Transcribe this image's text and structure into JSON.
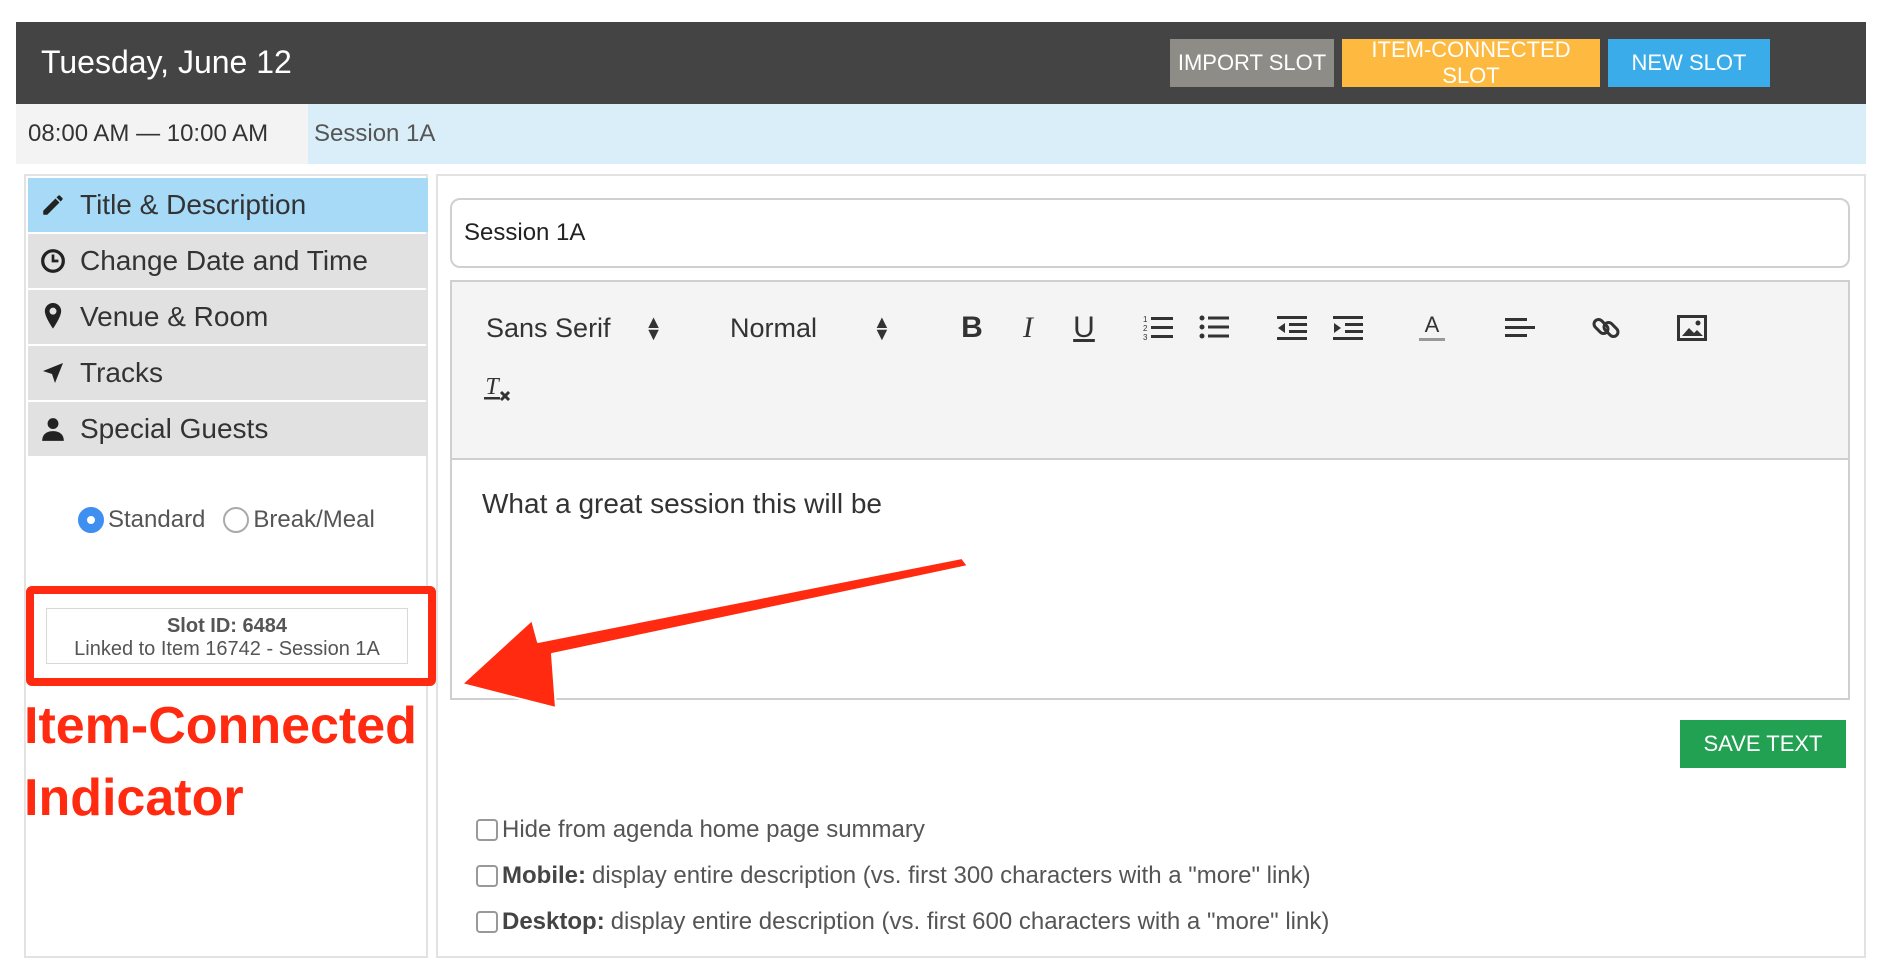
{
  "header": {
    "title": "Tuesday, June 12",
    "buttons": {
      "import": "IMPORT SLOT",
      "item_connected": "ITEM-CONNECTED SLOT",
      "new": "NEW SLOT"
    },
    "colors": {
      "bar": "#444444",
      "import": "#8e8c86",
      "item_connected": "#fdb940",
      "new": "#3aacea"
    }
  },
  "timebar": {
    "time_range": "08:00 AM — 10:00 AM",
    "session": "Session 1A"
  },
  "sidebar": {
    "items": [
      {
        "label": "Title & Description",
        "icon": "pencil-icon",
        "active": true
      },
      {
        "label": "Change Date and Time",
        "icon": "clock-icon",
        "active": false
      },
      {
        "label": "Venue & Room",
        "icon": "map-pin-icon",
        "active": false
      },
      {
        "label": "Tracks",
        "icon": "location-arrow-icon",
        "active": false
      },
      {
        "label": "Special Guests",
        "icon": "user-icon",
        "active": false
      }
    ],
    "slot_type": {
      "options": [
        "Standard",
        "Break/Meal"
      ],
      "selected": "Standard"
    },
    "slot_info": {
      "slot_id": "Slot ID: 6484",
      "linked": "Linked to Item 16742 - Session 1A"
    }
  },
  "annotation": {
    "line1": "Item-Connected",
    "line2": "Indicator",
    "color": "#ff2a0f"
  },
  "editor": {
    "title_value": "Session 1A",
    "font_family": "Sans Serif",
    "font_size": "Normal",
    "body": "What a great session this will be",
    "save_label": "SAVE TEXT",
    "toolbar_icons": [
      "bold-icon",
      "italic-icon",
      "underline-icon",
      "ordered-list-icon",
      "bullet-list-icon",
      "outdent-icon",
      "indent-icon",
      "text-color-icon",
      "align-icon",
      "link-icon",
      "image-icon",
      "clear-format-icon"
    ]
  },
  "options": {
    "hide": "Hide from agenda home page summary",
    "mobile_label": "Mobile:",
    "mobile_text": "display entire description (vs. first 300 characters with a \"more\" link)",
    "desktop_label": "Desktop:",
    "desktop_text": "display entire description (vs. first 600 characters with a \"more\" link)"
  }
}
